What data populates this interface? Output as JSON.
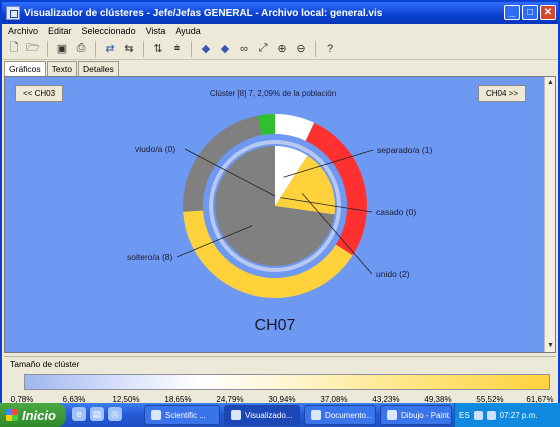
{
  "window": {
    "title": "Visualizador de clústeres - Jefe/Jefas GENERAL - Archivo local: general.vis"
  },
  "menu": [
    "Archivo",
    "Editar",
    "Seleccionado",
    "Vista",
    "Ayuda"
  ],
  "toolbar_icons": [
    "new-icon",
    "open-icon",
    "save-icon",
    "print-icon",
    "refresh-icon",
    "refresh-alt-icon",
    "sort-icon",
    "filter-icon",
    "back-arrow-icon",
    "forward-arrow-icon",
    "binoculars-icon",
    "zoom-fit-icon",
    "zoom-in-icon",
    "zoom-out-icon",
    "help-icon"
  ],
  "tabs": [
    "Gráficos",
    "Texto",
    "Detalles"
  ],
  "panel": {
    "prev_button": "<< CH03",
    "next_button": "CH04 >>",
    "header": "Clúster [8] 7, 2,09% de la población",
    "cluster_name": "CH07",
    "background": "#6d99f2"
  },
  "chart_data": {
    "type": "pie",
    "title": "CH07",
    "inner": [
      {
        "label": "viudo/a (0)",
        "value": 0,
        "color": "#ff3030"
      },
      {
        "label": "separado/a (1)",
        "value": 1,
        "color": "#ffffff"
      },
      {
        "label": "casado (0)",
        "value": 0,
        "color": "#2fbf2f"
      },
      {
        "label": "unido (2)",
        "value": 2,
        "color": "#ffd23c"
      },
      {
        "label": "soltero/a (8)",
        "value": 8,
        "color": "#808080"
      }
    ],
    "outer": [
      {
        "label": "separado/a",
        "value": 7,
        "color": "#ffffff"
      },
      {
        "label": "unido",
        "value": 27,
        "color": "#ff3030"
      },
      {
        "label": "soltero/a",
        "value": 40,
        "color": "#ffd23c"
      },
      {
        "label": "viudo/a",
        "value": 23,
        "color": "#808080"
      },
      {
        "label": "casado",
        "value": 3,
        "color": "#2fbf2f"
      }
    ]
  },
  "size_panel": {
    "title": "Tamaño de clúster",
    "scale": [
      "0,78%",
      "6,63%",
      "12,50%",
      "18,65%",
      "24,79%",
      "30,94%",
      "37,08%",
      "43,23%",
      "49,38%",
      "55,52%",
      "61,67%"
    ]
  },
  "taskbar": {
    "start": "Inicio",
    "tasks": [
      "Scientific ...",
      "Visualizado...",
      "Documento...",
      "Dibujo - Paint"
    ],
    "lang": "ES",
    "clock": "07:27 p.m."
  }
}
